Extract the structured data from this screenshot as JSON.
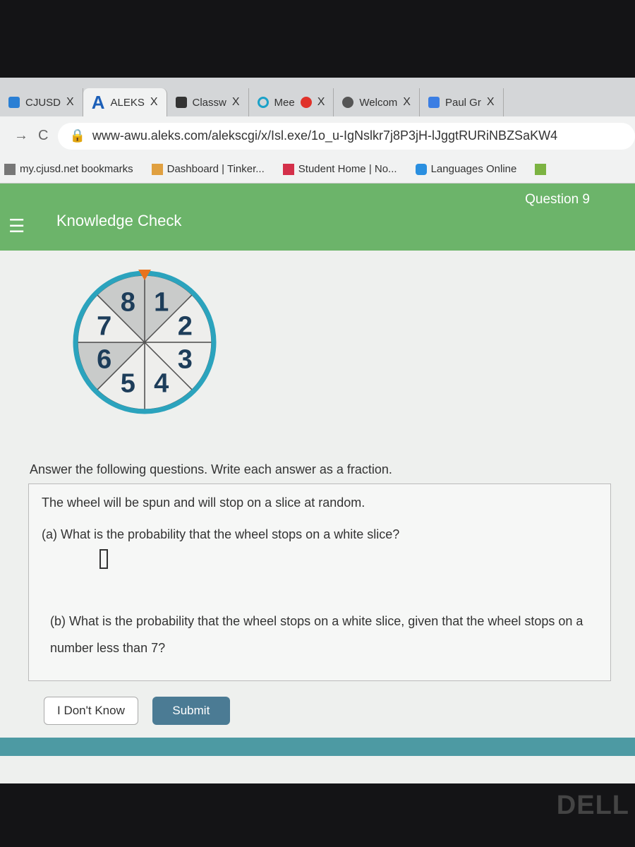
{
  "browser": {
    "tabs": [
      {
        "label": "CJUSD",
        "close": "X"
      },
      {
        "label": "ALEKS",
        "close": "X",
        "active": true
      },
      {
        "label": "Classw",
        "close": "X"
      },
      {
        "label": "Mee",
        "close": "X"
      },
      {
        "label": "Welcom",
        "close": "X"
      },
      {
        "label": "Paul Gr",
        "close": "X"
      }
    ],
    "url": "www-awu.aleks.com/alekscgi/x/Isl.exe/1o_u-IgNslkr7j8P3jH-lJggtRURiNBZSaKW4",
    "bookmarks": [
      "my.cjusd.net bookmarks",
      "Dashboard | Tinker...",
      "Student Home | No...",
      "Languages Online"
    ]
  },
  "header": {
    "title": "Knowledge Check",
    "question": "Question 9",
    "color": "#6cb46a"
  },
  "wheel": {
    "slices": [
      {
        "number": "1",
        "shade": "gray"
      },
      {
        "number": "2",
        "shade": "white"
      },
      {
        "number": "3",
        "shade": "white"
      },
      {
        "number": "4",
        "shade": "white"
      },
      {
        "number": "5",
        "shade": "white"
      },
      {
        "number": "6",
        "shade": "gray"
      },
      {
        "number": "7",
        "shade": "white"
      },
      {
        "number": "8",
        "shade": "gray"
      }
    ],
    "rim_color": "#2ba3bd",
    "pointer_color": "#e8731e"
  },
  "problem": {
    "instructions": "Answer the following questions. Write each answer as a fraction.",
    "intro": "The wheel will be spun and will stop on a slice at random.",
    "part_a": "(a)  What is the probability that the wheel stops on a white slice?",
    "part_b": "(b)  What is the probability that the wheel stops on a white slice, given that the wheel stops on a number less than 7?"
  },
  "buttons": {
    "dont_know": "I Don't Know",
    "submit": "Submit"
  },
  "brand": "DELL"
}
